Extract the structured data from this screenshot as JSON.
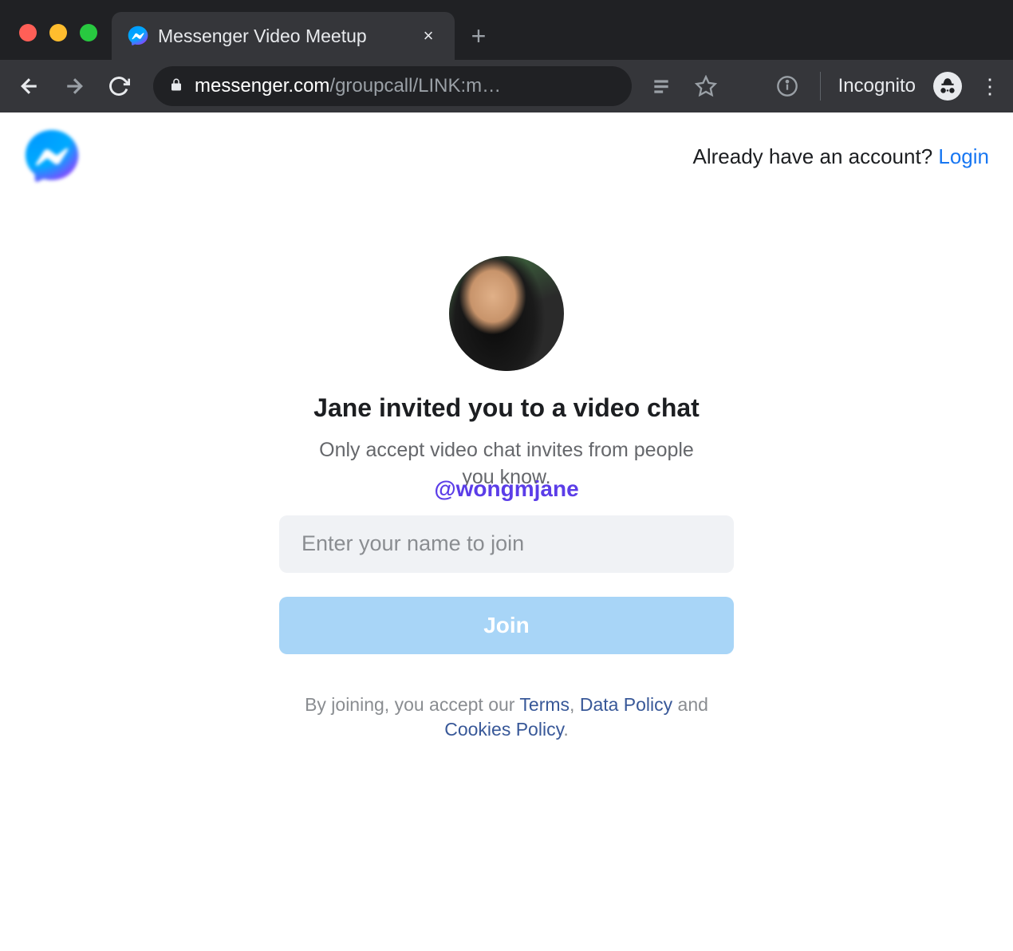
{
  "browser": {
    "tab_title": "Messenger Video Meetup",
    "url_host": "messenger.com",
    "url_path": "/groupcall/LINK:m…",
    "incognito_label": "Incognito",
    "new_tab": "+",
    "tab_close": "×"
  },
  "header": {
    "account_prompt": "Already have an account? ",
    "login": "Login"
  },
  "invite": {
    "title": "Jane invited you to a video chat",
    "subtitle": "Only accept video chat invites from people you know.",
    "watermark": "@wongmjane",
    "name_placeholder": "Enter your name to join",
    "join_label": "Join"
  },
  "legal": {
    "prefix": "By joining, you accept our ",
    "terms": "Terms",
    "sep1": ", ",
    "data_policy": "Data Policy",
    "sep2": " and ",
    "cookies_policy": "Cookies Policy",
    "suffix": "."
  }
}
